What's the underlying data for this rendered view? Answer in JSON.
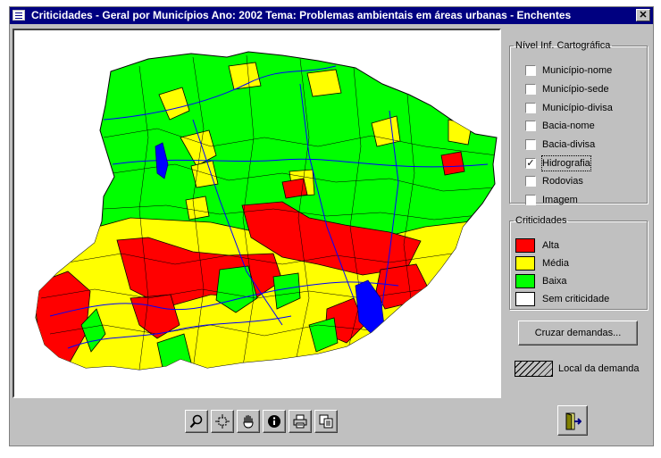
{
  "window": {
    "title": "Criticidades - Geral por Municípios  Ano: 2002  Tema: Problemas ambientais em áreas urbanas - Enchentes",
    "close_label": "✕"
  },
  "layers_panel": {
    "legend": "Nível  Inf.  Cartográfica",
    "items": [
      {
        "label": "Município-nome",
        "checked": false
      },
      {
        "label": "Município-sede",
        "checked": false
      },
      {
        "label": "Município-divisa",
        "checked": false
      },
      {
        "label": "Bacia-nome",
        "checked": false
      },
      {
        "label": "Bacia-divisa",
        "checked": false
      },
      {
        "label": "Hidrografia",
        "checked": true
      },
      {
        "label": "Rodovias",
        "checked": false
      },
      {
        "label": "Imagem",
        "checked": false
      }
    ]
  },
  "criticality_panel": {
    "legend": "Criticidades",
    "items": [
      {
        "label": "Alta",
        "color": "#ff0000"
      },
      {
        "label": "Média",
        "color": "#ffff00"
      },
      {
        "label": "Baixa",
        "color": "#00ff00"
      },
      {
        "label": "Sem criticidade",
        "color": "#ffffff"
      }
    ]
  },
  "cross_button": {
    "label": "Cruzar demandas..."
  },
  "demand_legend": {
    "label": "Local da demanda"
  },
  "toolbar": {
    "tools": [
      "zoom-icon",
      "extent-icon",
      "pan-hand-icon",
      "info-icon",
      "print-icon",
      "copy-icon"
    ]
  },
  "colors": {
    "high": "#ff0000",
    "medium": "#ffff00",
    "low": "#00ff00",
    "water": "#0000ff",
    "titlebar": "#000080"
  }
}
